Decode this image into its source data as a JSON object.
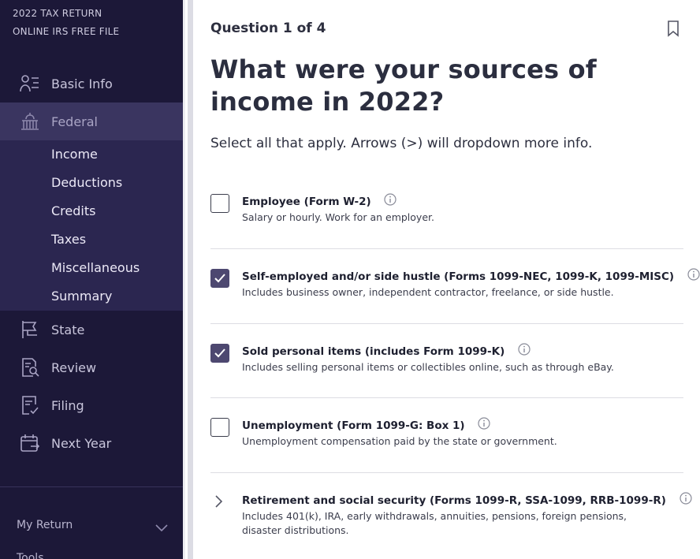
{
  "sidebar": {
    "brand_line1": "2022 TAX RETURN",
    "brand_line2": "ONLINE IRS FREE FILE",
    "items": [
      {
        "label": "Basic Info",
        "icon": "person-list-icon"
      },
      {
        "label": "Federal",
        "icon": "capitol-icon"
      },
      {
        "label": "State",
        "icon": "flag-icon"
      },
      {
        "label": "Review",
        "icon": "document-search-icon"
      },
      {
        "label": "Filing",
        "icon": "document-check-icon"
      },
      {
        "label": "Next Year",
        "icon": "calendar-arrow-icon"
      }
    ],
    "federal_subitems": [
      "Income",
      "Deductions",
      "Credits",
      "Taxes",
      "Miscellaneous",
      "Summary"
    ],
    "my_return_label": "My Return",
    "tools_label": "Tools"
  },
  "main": {
    "question_number": "Question 1 of 4",
    "title": "What were your sources of income in 2022?",
    "subtitle": "Select all that apply. Arrows (>) will dropdown more info.",
    "options": [
      {
        "label": "Employee (Form W-2)",
        "description": "Salary or hourly. Work for an employer.",
        "checked": false
      },
      {
        "label": "Self-employed and/or side hustle (Forms 1099-NEC, 1099-K, 1099-MISC)",
        "description": "Includes business owner, independent contractor, freelance, or side hustle.",
        "checked": true
      },
      {
        "label": "Sold personal items (includes Form 1099-K)",
        "description": "Includes selling personal items or collectibles online, such as through eBay.",
        "checked": true
      },
      {
        "label": "Unemployment (Form 1099-G: Box 1)",
        "description": "Unemployment compensation paid by the state or government.",
        "checked": false
      },
      {
        "label": "Retirement and social security (Forms 1099-R, SSA-1099, RRB-1099-R)",
        "description": "Includes 401(k), IRA, early withdrawals, annuities, pensions, foreign pensions, disaster distributions.",
        "expandable": true
      }
    ]
  },
  "colors": {
    "sidebar_bg": "#1c1838",
    "sidebar_active": "#3a3560",
    "subnav_bg": "#2b2650",
    "checkbox_checked": "#4d4870"
  }
}
